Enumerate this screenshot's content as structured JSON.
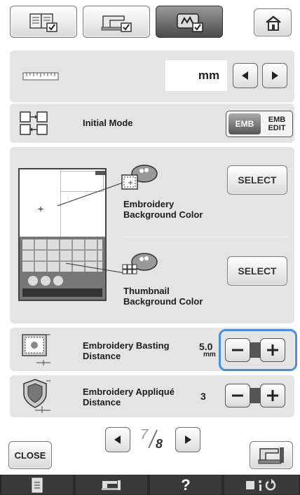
{
  "header": {
    "tabs": [
      {
        "icon": "book-settings-icon"
      },
      {
        "icon": "machine-settings-icon"
      },
      {
        "icon": "embroidery-settings-icon",
        "active": true
      }
    ],
    "home_icon": "home-icon"
  },
  "unit_row": {
    "icon": "ruler-icon",
    "value": "mm"
  },
  "initial_mode": {
    "label": "Initial Mode",
    "options": [
      "EMB",
      "EMB EDIT"
    ],
    "selected": "EMB"
  },
  "background": {
    "embroidery_label_line1": "Embroidery",
    "embroidery_label_line2": "Background Color",
    "embroidery_select": "SELECT",
    "thumbnail_label_line1": "Thumbnail",
    "thumbnail_label_line2": "Background Color",
    "thumbnail_select": "SELECT"
  },
  "basting": {
    "label_line1": "Embroidery Basting",
    "label_line2": "Distance",
    "value": "5.0",
    "unit": "mm"
  },
  "applique": {
    "label_line1": "Embroidery Appliqué",
    "label_line2": "Distance",
    "value": "3"
  },
  "pager": {
    "current": "7",
    "total": "8"
  },
  "close_label": "CLOSE",
  "footer": {
    "help": "?"
  }
}
